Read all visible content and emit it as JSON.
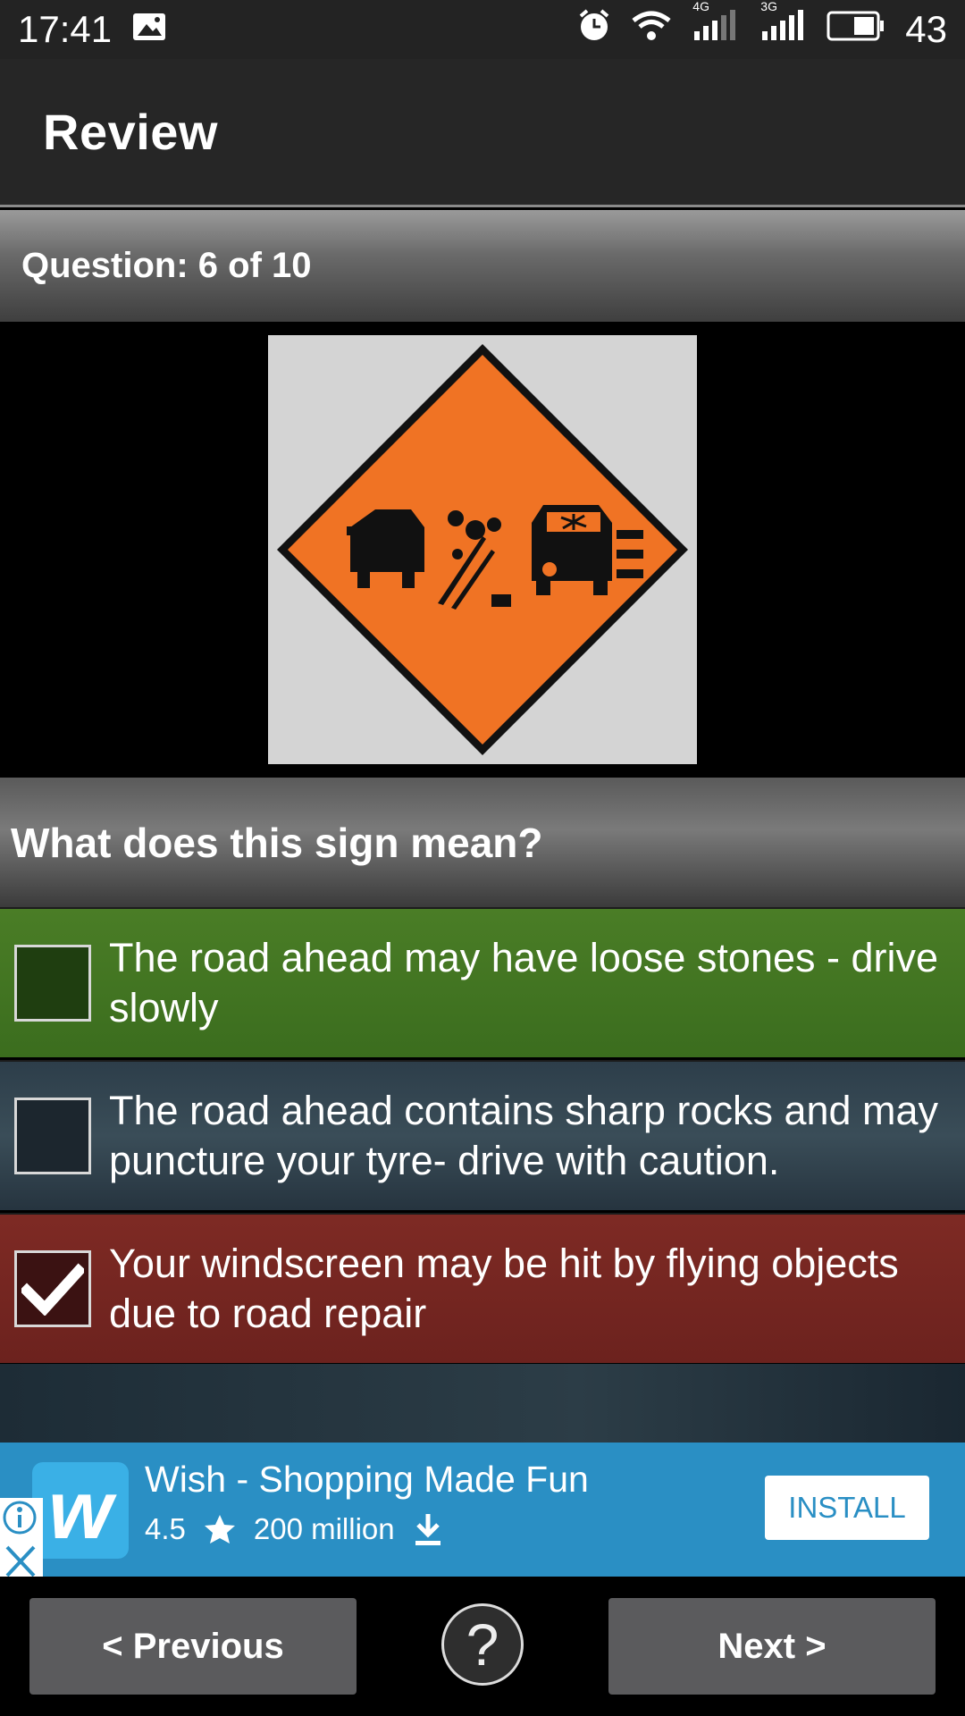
{
  "status_bar": {
    "time": "17:41",
    "battery": "43",
    "network_4g": "4G",
    "network_3g": "3G",
    "icons": [
      "gallery-icon",
      "alarm-icon",
      "wifi-icon",
      "signal-4g-icon",
      "signal-3g-icon",
      "battery-icon"
    ]
  },
  "app_bar": {
    "title": "Review"
  },
  "question": {
    "counter": "Question: 6 of 10",
    "prompt": "What does this sign mean?",
    "sign_image": "flying-stones-warning-sign",
    "sign_color": "#f07324"
  },
  "options": [
    {
      "text": "The road ahead may have loose stones - drive slowly",
      "checked": false,
      "status_color": "#4a7d26"
    },
    {
      "text": "The road ahead contains sharp rocks and may puncture your tyre- drive with caution.",
      "checked": false,
      "status_color": "#2d3e4a"
    },
    {
      "text": "Your windscreen may be hit by flying objects due to road repair",
      "checked": true,
      "status_color": "#7e2a24"
    }
  ],
  "ad": {
    "logo_letter": "w",
    "title": "Wish - Shopping Made Fun",
    "rating": "4.5",
    "downloads": "200 million",
    "install_label": "INSTALL",
    "accent": "#2a8fc4"
  },
  "nav": {
    "previous_label": "< Previous",
    "help_label": "?",
    "next_label": "Next >"
  }
}
